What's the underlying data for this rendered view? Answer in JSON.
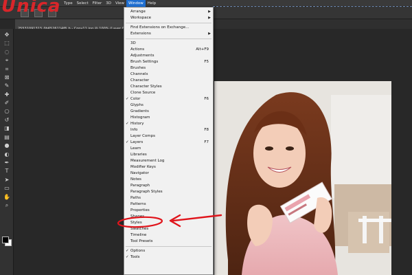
{
  "app": {
    "logo_text": "Unica",
    "document_tab": "25531091313_0b6526114f8_b - Copy11.jpg @ 100% (Layer 0, RGB/8)"
  },
  "menubar": {
    "items": [
      "Type",
      "Select",
      "Filter",
      "3D",
      "View",
      "Window",
      "Help"
    ],
    "active": "Window"
  },
  "window_menu": {
    "top": [
      {
        "label": "Arrange",
        "submenu": true
      },
      {
        "label": "Workspace",
        "submenu": true
      }
    ],
    "extensions": [
      {
        "label": "Find Extensions on Exchange..."
      },
      {
        "label": "Extensions",
        "submenu": true
      }
    ],
    "panels": [
      {
        "label": "3D",
        "check": "",
        "shortcut": ""
      },
      {
        "label": "Actions",
        "check": "",
        "shortcut": "Alt+F9"
      },
      {
        "label": "Adjustments",
        "check": "",
        "shortcut": ""
      },
      {
        "label": "Brush Settings",
        "check": "",
        "shortcut": "F5"
      },
      {
        "label": "Brushes",
        "check": "",
        "shortcut": ""
      },
      {
        "label": "Channels",
        "check": "",
        "shortcut": ""
      },
      {
        "label": "Character",
        "check": "",
        "shortcut": ""
      },
      {
        "label": "Character Styles",
        "check": "",
        "shortcut": ""
      },
      {
        "label": "Clone Source",
        "check": "",
        "shortcut": ""
      },
      {
        "label": "Color",
        "check": "✓",
        "shortcut": "F6"
      },
      {
        "label": "Glyphs",
        "check": "",
        "shortcut": ""
      },
      {
        "label": "Gradients",
        "check": "",
        "shortcut": ""
      },
      {
        "label": "Histogram",
        "check": "",
        "shortcut": ""
      },
      {
        "label": "History",
        "check": "✓",
        "shortcut": ""
      },
      {
        "label": "Info",
        "check": "",
        "shortcut": "F8"
      },
      {
        "label": "Layer Comps",
        "check": "",
        "shortcut": ""
      },
      {
        "label": "Layers",
        "check": "✓",
        "shortcut": "F7"
      },
      {
        "label": "Learn",
        "check": "",
        "shortcut": ""
      },
      {
        "label": "Libraries",
        "check": "",
        "shortcut": ""
      },
      {
        "label": "Measurement Log",
        "check": "",
        "shortcut": ""
      },
      {
        "label": "Modifier Keys",
        "check": "",
        "shortcut": ""
      },
      {
        "label": "Navigator",
        "check": "",
        "shortcut": ""
      },
      {
        "label": "Notes",
        "check": "",
        "shortcut": ""
      },
      {
        "label": "Paragraph",
        "check": "",
        "shortcut": ""
      },
      {
        "label": "Paragraph Styles",
        "check": "",
        "shortcut": ""
      },
      {
        "label": "Paths",
        "check": "",
        "shortcut": ""
      },
      {
        "label": "Patterns",
        "check": "",
        "shortcut": ""
      },
      {
        "label": "Properties",
        "check": "",
        "shortcut": ""
      },
      {
        "label": "Shapes",
        "check": "",
        "shortcut": ""
      },
      {
        "label": "Styles",
        "check": "",
        "shortcut": ""
      },
      {
        "label": "Swatches",
        "check": "",
        "shortcut": ""
      },
      {
        "label": "Timeline",
        "check": "",
        "shortcut": ""
      },
      {
        "label": "Tool Presets",
        "check": "",
        "shortcut": ""
      }
    ],
    "bottom": [
      {
        "label": "Options",
        "check": "✓"
      },
      {
        "label": "Tools",
        "check": "✓"
      }
    ]
  },
  "colors": {
    "menubar_bg": "#3a3a3a",
    "menu_bg": "#f1f1f1",
    "highlight": "#1f6fd1",
    "annotation": "#e0141b",
    "logo_red": "#d8262a",
    "logo_blue": "#1c62c8"
  },
  "icons": {
    "tools": [
      "move-icon",
      "marquee-icon",
      "lasso-icon",
      "quick-select-icon",
      "crop-icon",
      "frame-icon",
      "eyedropper-icon",
      "healing-icon",
      "brush-icon",
      "stamp-icon",
      "history-brush-icon",
      "eraser-icon",
      "gradient-icon",
      "blur-icon",
      "dodge-icon",
      "pen-icon",
      "type-icon",
      "path-select-icon",
      "shape-icon",
      "hand-icon",
      "zoom-icon"
    ]
  }
}
